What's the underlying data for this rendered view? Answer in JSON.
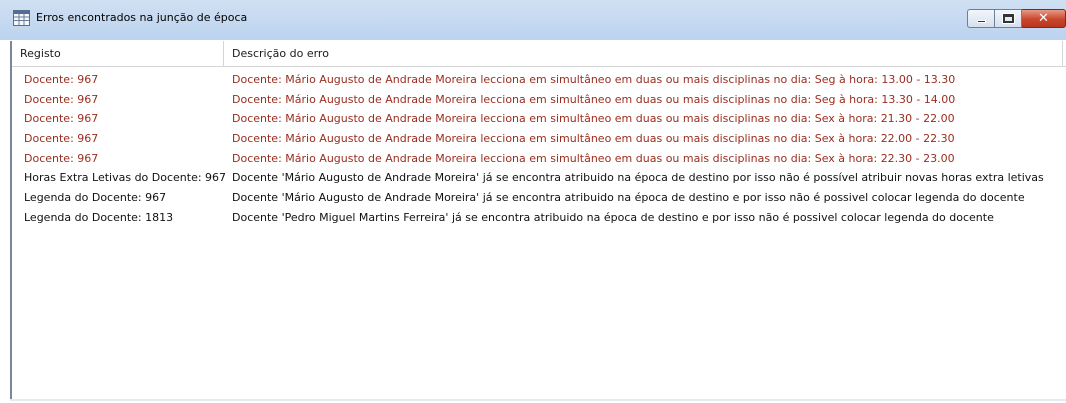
{
  "window": {
    "title": "Erros encontrados na junção de época",
    "icon": "table-icon",
    "controls": {
      "minimize": "minimize-icon",
      "maximize": "maximize-icon",
      "close_glyph": "✕"
    }
  },
  "table": {
    "columns": [
      "Registo",
      "Descrição do erro"
    ],
    "rows": [
      {
        "type": "error",
        "registo": "Docente:  967",
        "descricao": "Docente: Mário Augusto de Andrade Moreira lecciona em simultâneo em duas ou mais disciplinas no dia: Seg à hora: 13.00 - 13.30"
      },
      {
        "type": "error",
        "registo": "Docente:  967",
        "descricao": "Docente: Mário Augusto de Andrade Moreira lecciona em simultâneo em duas ou mais disciplinas no dia: Seg à hora: 13.30 - 14.00"
      },
      {
        "type": "error",
        "registo": "Docente:  967",
        "descricao": "Docente: Mário Augusto de Andrade Moreira lecciona em simultâneo em duas ou mais disciplinas no dia: Sex à hora: 21.30 - 22.00"
      },
      {
        "type": "error",
        "registo": "Docente:  967",
        "descricao": "Docente: Mário Augusto de Andrade Moreira lecciona em simultâneo em duas ou mais disciplinas no dia: Sex à hora: 22.00 - 22.30"
      },
      {
        "type": "error",
        "registo": "Docente:  967",
        "descricao": "Docente: Mário Augusto de Andrade Moreira lecciona em simultâneo em duas ou mais disciplinas no dia: Sex à hora: 22.30 - 23.00"
      },
      {
        "type": "info",
        "registo": "Horas Extra Letivas do Docente:  967",
        "descricao": "Docente 'Mário Augusto de Andrade Moreira' já se encontra atribuido na época de destino por isso não é possível atribuir novas horas extra letivas"
      },
      {
        "type": "info",
        "registo": "Legenda do Docente:  967",
        "descricao": "Docente 'Mário Augusto de Andrade Moreira' já se encontra atribuido na época de destino e por isso não é possivel colocar legenda do docente"
      },
      {
        "type": "info",
        "registo": "Legenda do Docente: 1813",
        "descricao": "Docente 'Pedro Miguel Martins Ferreira' já se encontra atribuido na época de destino e por isso não é possivel colocar legenda do docente"
      }
    ]
  },
  "colors": {
    "error_text": "#9b2d1f",
    "info_text": "#111111",
    "titlebar": "#c6daf1",
    "close_button": "#c9462c"
  }
}
